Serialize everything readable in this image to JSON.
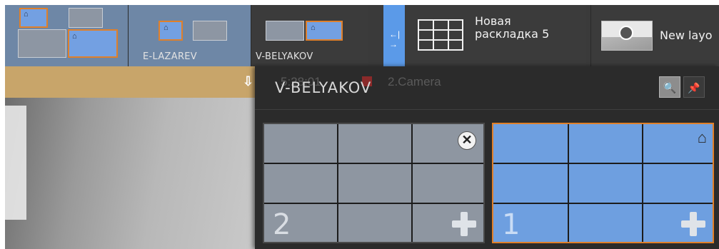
{
  "ribbon": {
    "tiles": [
      {
        "label": "",
        "state": "active"
      },
      {
        "label": "E-LAZAREV",
        "state": "active-light"
      },
      {
        "label": "V-BELYAKOV",
        "state": "normal"
      }
    ],
    "new_layout": {
      "line1": "Новая",
      "line2": "раскладка 5"
    },
    "map_layout": {
      "label": "New layo"
    }
  },
  "camera": {
    "behind_time": "5:28:01",
    "behind_name": "2.Camera"
  },
  "panel": {
    "title": "V-BELYAKOV",
    "search_glyph": "🔍",
    "pin_glyph": "📌",
    "cards": [
      {
        "number": "2",
        "color": "#8e96a1",
        "close_glyph": "✕",
        "plus": "add"
      },
      {
        "number": "1",
        "color": "#6e9fe0",
        "home_glyph": "⌂",
        "plus": "add"
      }
    ]
  },
  "colors": {
    "accent_orange": "#e0802a",
    "accent_blue": "#6e9fe0",
    "panel_bg": "#2b2b2b",
    "header_gold": "#c8a56a"
  }
}
